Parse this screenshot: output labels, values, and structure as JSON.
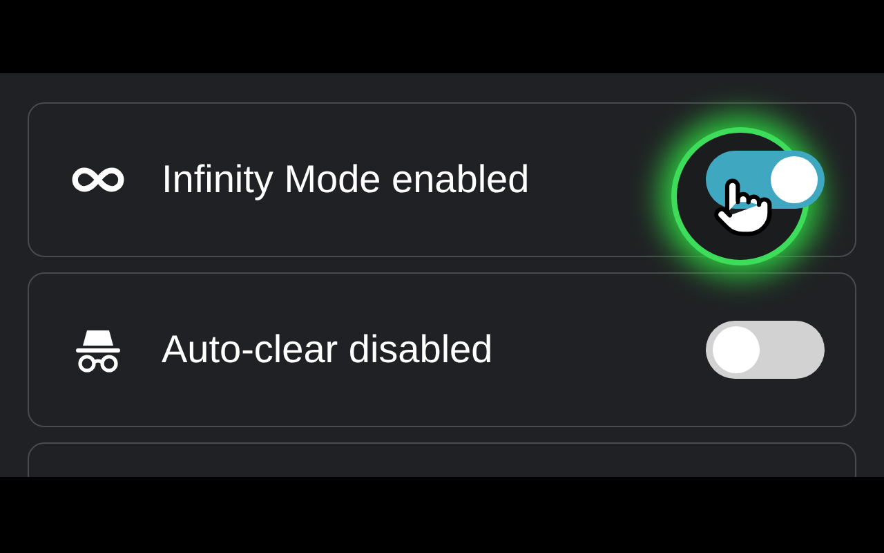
{
  "settings": [
    {
      "kind": "infinity",
      "label": "Infinity Mode enabled",
      "on": true,
      "highlighted": true
    },
    {
      "kind": "incognito",
      "label": "Auto-clear disabled",
      "on": false,
      "highlighted": false
    }
  ]
}
